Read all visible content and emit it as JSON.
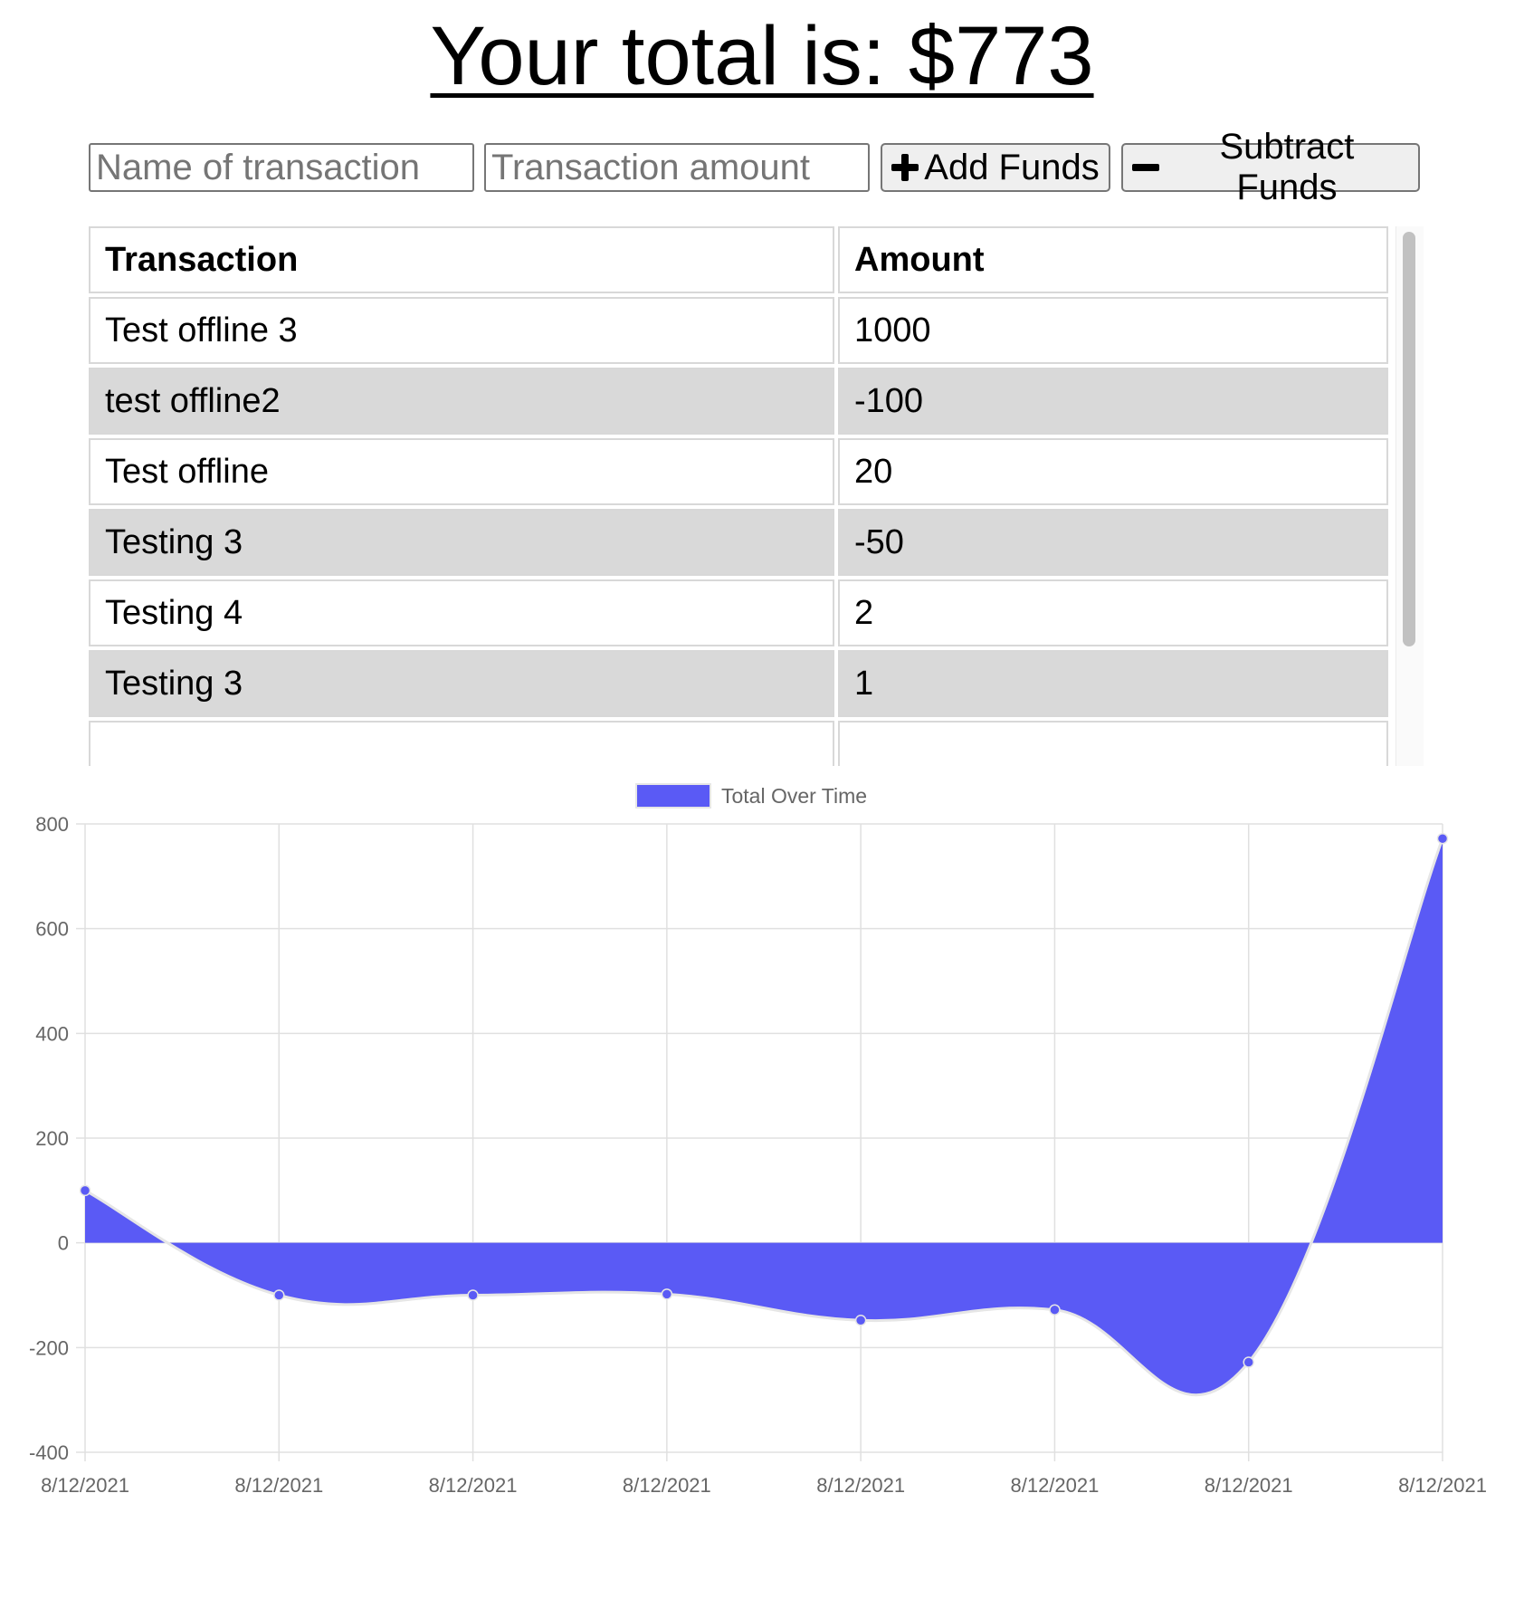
{
  "header": {
    "total_text": "Your total is: $773"
  },
  "form": {
    "name_placeholder": "Name of transaction",
    "amount_placeholder": "Transaction amount",
    "add_label": "Add Funds",
    "subtract_label": "Subtract Funds",
    "add_icon": "plus-icon",
    "subtract_icon": "minus-icon"
  },
  "table": {
    "headers": [
      "Transaction",
      "Amount"
    ],
    "rows": [
      {
        "name": "Test offline 3",
        "amount": "1000"
      },
      {
        "name": "test offline2",
        "amount": "-100"
      },
      {
        "name": "Test offline",
        "amount": "20"
      },
      {
        "name": "Testing 3",
        "amount": "-50"
      },
      {
        "name": "Testing 4",
        "amount": "2"
      },
      {
        "name": "Testing 3",
        "amount": "1"
      }
    ]
  },
  "colors": {
    "series_fill": "#5a5af5",
    "series_point": "#5a5af5",
    "row_shade": "#d9d9d9"
  },
  "chart_data": {
    "type": "area",
    "title": "",
    "xlabel": "",
    "ylabel": "",
    "x": [
      "8/12/2021",
      "8/12/2021",
      "8/12/2021",
      "8/12/2021",
      "8/12/2021",
      "8/12/2021",
      "8/12/2021",
      "8/12/2021"
    ],
    "series": [
      {
        "name": "Total Over Time",
        "values": [
          100,
          -100,
          -100,
          -98,
          -148,
          -128,
          -228,
          772
        ]
      }
    ],
    "ylim": [
      -400,
      800
    ],
    "yticks": [
      800,
      600,
      400,
      200,
      0,
      -200,
      -400
    ],
    "grid": true,
    "legend": "top-center",
    "smooth": true
  }
}
